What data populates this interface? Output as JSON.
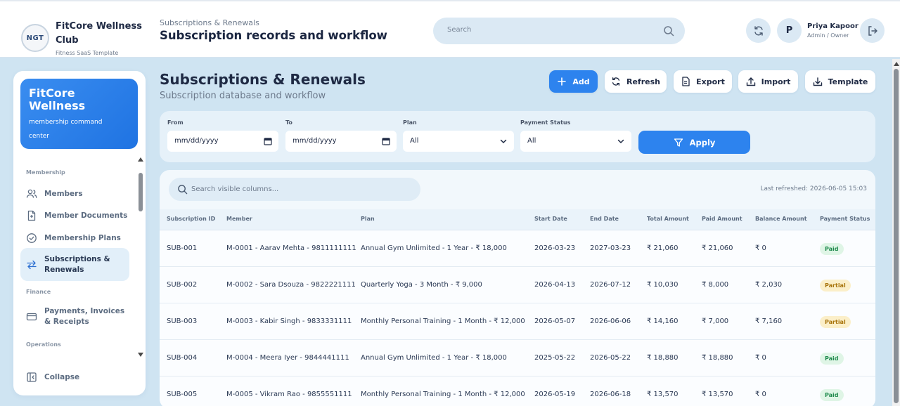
{
  "brand": {
    "logo_text": "NGT",
    "name": "FitCore Wellness Club",
    "subtitle": "Fitness SaaS Template"
  },
  "header": {
    "breadcrumb": "Subscriptions & Renewals",
    "title": "Subscription records and workflow",
    "search_placeholder": "Search"
  },
  "user": {
    "initial": "P",
    "name": "Priya Kapoor",
    "role": "Admin / Owner"
  },
  "sidebar": {
    "hero_title": "FitCore Wellness",
    "hero_subtitle": "membership command center",
    "sections": [
      "Membership",
      "Finance",
      "Operations"
    ],
    "items": [
      {
        "label": "Members",
        "icon": "users-icon"
      },
      {
        "label": "Member Documents",
        "icon": "document-icon"
      },
      {
        "label": "Membership Plans",
        "icon": "check-circle-icon"
      },
      {
        "label": "Subscriptions & Renewals",
        "icon": "swap-arrows-icon"
      },
      {
        "label": "Payments, Invoices & Receipts",
        "icon": "card-icon"
      }
    ],
    "collapse_label": "Collapse"
  },
  "panel": {
    "title": "Subscriptions & Renewals",
    "subtitle": "Subscription database and workflow",
    "buttons": {
      "add": "Add",
      "refresh": "Refresh",
      "export": "Export",
      "import": "Import",
      "template": "Template"
    }
  },
  "filters": {
    "from_label": "From",
    "from_value": "mm/dd/yyyy",
    "to_label": "To",
    "to_value": "mm/dd/yyyy",
    "plan_label": "Plan",
    "plan_value": "All",
    "status_label": "Payment Status",
    "status_value": "All",
    "apply_label": "Apply"
  },
  "table": {
    "search_placeholder": "Search visible columns...",
    "last_refreshed": "Last refreshed: 2026-06-05 15:03",
    "columns": [
      "Subscription ID",
      "Member",
      "Plan",
      "Start Date",
      "End Date",
      "Total Amount",
      "Paid Amount",
      "Balance Amount",
      "Payment Status"
    ],
    "rows": [
      [
        "SUB-001",
        "M-0001 - Aarav Mehta - 9811111111",
        "Annual Gym Unlimited - 1 Year - ₹ 18,000",
        "2026-03-23",
        "2027-03-23",
        "₹ 21,060",
        "₹ 21,060",
        "₹ 0",
        "Paid"
      ],
      [
        "SUB-002",
        "M-0002 - Sara Dsouza - 9822221111",
        "Quarterly Yoga - 3 Month - ₹ 9,000",
        "2026-04-13",
        "2026-07-12",
        "₹ 10,030",
        "₹ 8,000",
        "₹ 2,030",
        "Partial"
      ],
      [
        "SUB-003",
        "M-0003 - Kabir Singh - 9833331111",
        "Monthly Personal Training - 1 Month - ₹ 12,000",
        "2026-05-07",
        "2026-06-06",
        "₹ 14,160",
        "₹ 7,000",
        "₹ 7,160",
        "Partial"
      ],
      [
        "SUB-004",
        "M-0004 - Meera Iyer - 9844441111",
        "Annual Gym Unlimited - 1 Year - ₹ 18,000",
        "2025-05-22",
        "2026-05-22",
        "₹ 18,880",
        "₹ 18,880",
        "₹ 0",
        "Paid"
      ],
      [
        "SUB-005",
        "M-0005 - Vikram Rao - 9855551111",
        "Monthly Personal Training - 1 Month - ₹ 12,000",
        "2026-05-19",
        "2026-06-18",
        "₹ 13,570",
        "₹ 13,570",
        "₹ 0",
        "Paid"
      ]
    ]
  },
  "colors": {
    "accent": "#2d83ee",
    "paid_bg": "#dff5e6",
    "paid_fg": "#1f8a4c",
    "partial_bg": "#fbefc9",
    "partial_fg": "#a8740c"
  }
}
